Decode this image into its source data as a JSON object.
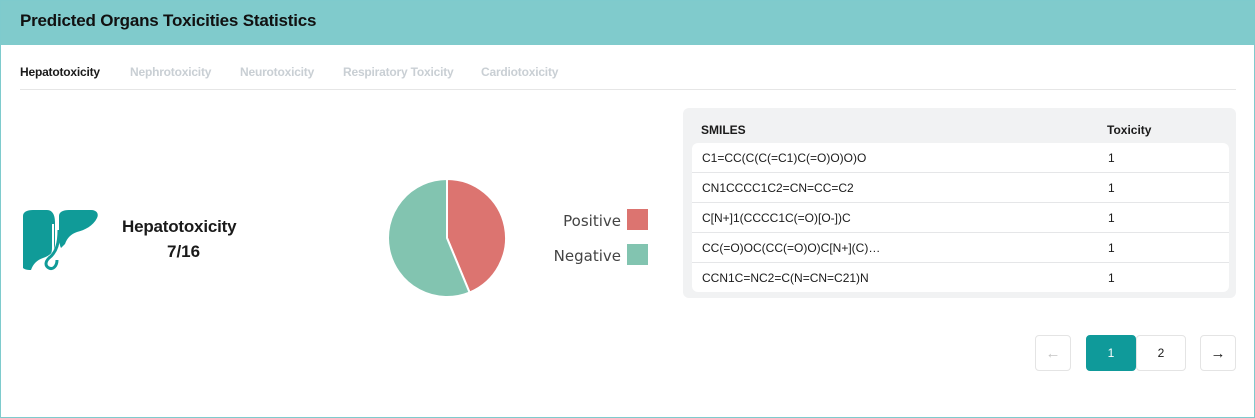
{
  "panel": {
    "title": "Predicted Organs Toxicities Statistics",
    "header_color": "#80cbcc"
  },
  "tabs": [
    {
      "label": "Hepatotoxicity",
      "active": true
    },
    {
      "label": "Nephrotoxicity",
      "active": false
    },
    {
      "label": "Neurotoxicity",
      "active": false
    },
    {
      "label": "Respiratory Toxicity",
      "active": false
    },
    {
      "label": "Cardiotoxicity",
      "active": false
    }
  ],
  "summary": {
    "icon": "liver-icon",
    "name": "Hepatotoxicity",
    "count": "7/16"
  },
  "chart_data": {
    "type": "pie",
    "labels": [
      "Positive",
      "Negative"
    ],
    "values": [
      7,
      9
    ],
    "colors": [
      "#dc7470",
      "#82c4b0"
    ]
  },
  "legend": [
    {
      "label": "Positive",
      "color": "#dc7470"
    },
    {
      "label": "Negative",
      "color": "#82c4b0"
    }
  ],
  "table": {
    "headers": [
      "SMILES",
      "Toxicity"
    ],
    "rows": [
      [
        "C1=CC(C(C(=C1)C(=O)O)O)O",
        "1"
      ],
      [
        "CN1CCCC1C2=CN=CC=C2",
        "1"
      ],
      [
        "C[N+]1(CCCC1C(=O)[O-])C",
        "1"
      ],
      [
        "CC(=O)OC(CC(=O)O)C[N+](C)…",
        "1"
      ],
      [
        "CCN1C=NC2=C(N=CN=C21)N",
        "1"
      ]
    ]
  },
  "pagination": {
    "prev_icon": "arrow-left-icon",
    "next_icon": "arrow-right-icon",
    "prev_symbol": "←",
    "next_symbol": "→",
    "pages": [
      "1",
      "2"
    ],
    "current": "1",
    "accent": "#0f9a9a"
  }
}
